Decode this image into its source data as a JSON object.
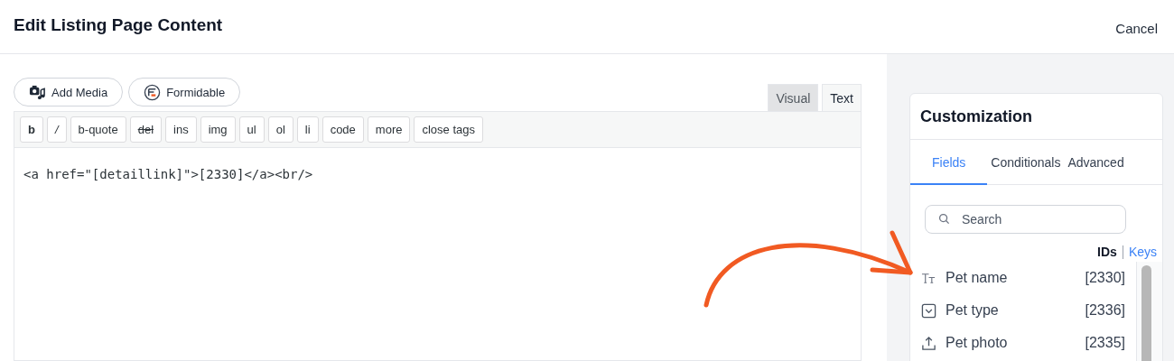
{
  "header": {
    "title": "Edit Listing Page Content",
    "cancel": "Cancel"
  },
  "media_buttons": [
    {
      "label": "Add Media",
      "kind": "media"
    },
    {
      "label": "Formidable",
      "kind": "formidable"
    }
  ],
  "editor_tabs": [
    {
      "label": "Visual",
      "selected": false
    },
    {
      "label": "Text",
      "selected": true
    }
  ],
  "quicktags": [
    {
      "label": "b",
      "kind": "bold"
    },
    {
      "label": "/",
      "kind": "italic"
    },
    {
      "label": "b-quote",
      "kind": "plain"
    },
    {
      "label": "del",
      "kind": "strike"
    },
    {
      "label": "ins",
      "kind": "plain"
    },
    {
      "label": "img",
      "kind": "plain"
    },
    {
      "label": "ul",
      "kind": "plain"
    },
    {
      "label": "ol",
      "kind": "plain"
    },
    {
      "label": "li",
      "kind": "plain"
    },
    {
      "label": "code",
      "kind": "plain"
    },
    {
      "label": "more",
      "kind": "plain"
    },
    {
      "label": "close tags",
      "kind": "plain"
    }
  ],
  "content": "<a href=\"[detaillink]\">[2330]</a><br/>",
  "panel": {
    "title": "Customization",
    "tabs": [
      {
        "label": "Fields",
        "selected": true
      },
      {
        "label": "Conditionals",
        "selected": false
      },
      {
        "label": "Advanced",
        "selected": false
      }
    ],
    "search": {
      "placeholder": "Search"
    },
    "key_modes": [
      {
        "label": "IDs",
        "selected": true
      },
      {
        "label": "Keys",
        "selected": false
      }
    ],
    "fields": [
      {
        "name": "Pet name",
        "id": "[2330]",
        "kind": "text"
      },
      {
        "name": "Pet type",
        "id": "[2336]",
        "kind": "dropdown"
      },
      {
        "name": "Pet photo",
        "id": "[2335]",
        "kind": "upload"
      }
    ]
  }
}
